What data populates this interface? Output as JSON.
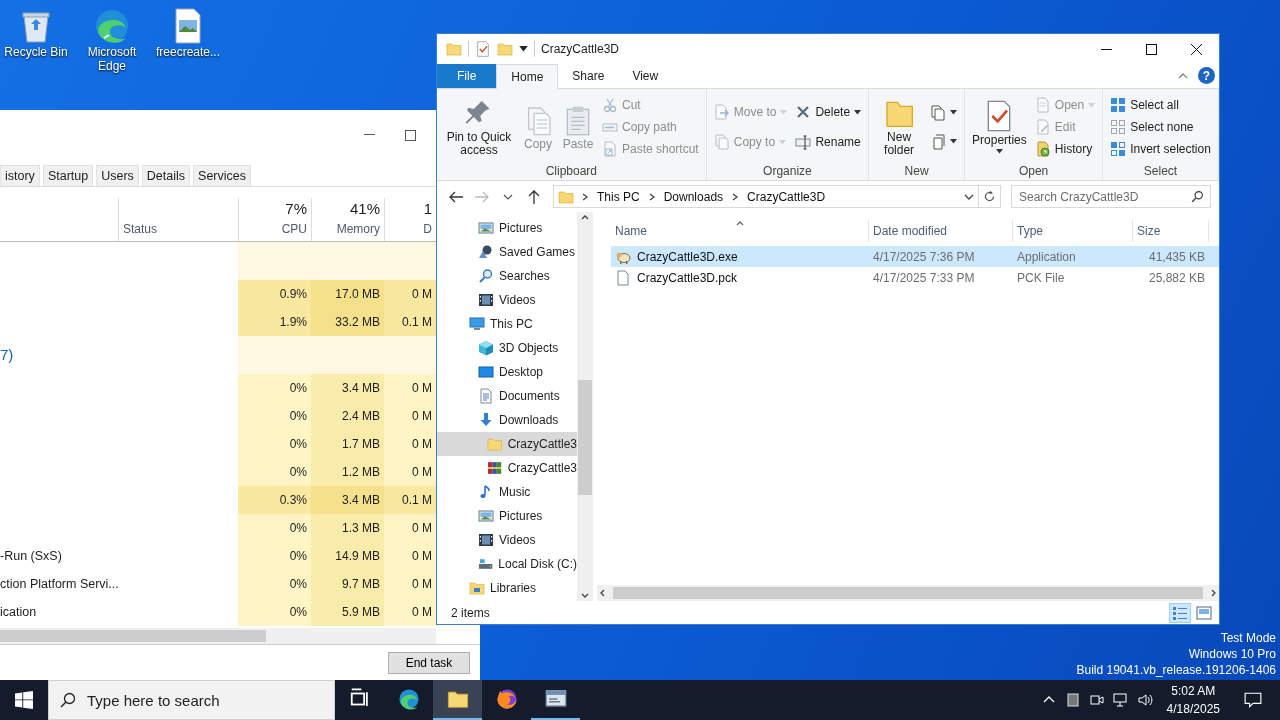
{
  "desktop_icons": [
    {
      "label": "Recycle Bin"
    },
    {
      "label": "Microsoft Edge"
    },
    {
      "label": "freecreate..."
    }
  ],
  "task_manager": {
    "tabs": [
      {
        "label": "istory",
        "selected": false
      },
      {
        "label": "Startup",
        "selected": false
      },
      {
        "label": "Users",
        "selected": false
      },
      {
        "label": "Details",
        "selected": false
      },
      {
        "label": "Services",
        "selected": false
      }
    ],
    "columns": [
      {
        "label": "Status"
      },
      {
        "total": "7%",
        "label": "CPU"
      },
      {
        "total": "41%",
        "label": "Memory"
      },
      {
        "total": "1",
        "label": "D"
      }
    ],
    "rows": [
      {
        "kind": "group"
      },
      {
        "kind": "process",
        "busy": true,
        "cpu": "0.9%",
        "memory": "17.0 MB",
        "disk": "0 M"
      },
      {
        "kind": "process",
        "busy": true,
        "cpu": "1.9%",
        "memory": "33.2 MB",
        "disk": "0.1 M"
      },
      {
        "kind": "group",
        "name": "7)"
      },
      {
        "kind": "process",
        "busy": false,
        "cpu": "0%",
        "memory": "3.4 MB",
        "disk": "0 M"
      },
      {
        "kind": "process",
        "busy": false,
        "cpu": "0%",
        "memory": "2.4 MB",
        "disk": "0 M"
      },
      {
        "kind": "process",
        "busy": false,
        "cpu": "0%",
        "memory": "1.7 MB",
        "disk": "0 M"
      },
      {
        "kind": "process",
        "busy": false,
        "cpu": "0%",
        "memory": "1.2 MB",
        "disk": "0 M"
      },
      {
        "kind": "process",
        "busy": true,
        "cpu": "0.3%",
        "memory": "3.4 MB",
        "disk": "0.1 M"
      },
      {
        "kind": "process",
        "busy": false,
        "cpu": "0%",
        "memory": "1.3 MB",
        "disk": "0 M"
      },
      {
        "kind": "process",
        "busy": false,
        "name": "-Run (SxS)",
        "cpu": "0%",
        "memory": "14.9 MB",
        "disk": "0 M"
      },
      {
        "kind": "process",
        "busy": false,
        "name": "ction Platform Servi...",
        "cpu": "0%",
        "memory": "9.7 MB",
        "disk": "0 M"
      },
      {
        "kind": "process",
        "busy": false,
        "name": "ication",
        "cpu": "0%",
        "memory": "5.9 MB",
        "disk": "0 M"
      }
    ],
    "end_task": "End task"
  },
  "explorer": {
    "title": "CrazyCattle3D",
    "tabs": [
      {
        "label": "File",
        "kind": "file",
        "selected": false
      },
      {
        "label": "Home",
        "kind": "tab",
        "selected": true
      },
      {
        "label": "Share",
        "kind": "tab",
        "selected": false
      },
      {
        "label": "View",
        "kind": "tab",
        "selected": false
      }
    ],
    "help": "?",
    "ribbon": [
      {
        "label": "Clipboard",
        "columns": [
          [
            {
              "label": "Pin to Quick access",
              "disabled": false
            }
          ],
          [
            {
              "label": "Copy",
              "disabled": true
            }
          ],
          [
            {
              "label": "Paste",
              "disabled": true
            }
          ],
          [
            {
              "label": "Cut",
              "disabled": true
            },
            {
              "label": "Copy path",
              "disabled": true
            },
            {
              "label": "Paste shortcut",
              "disabled": true
            }
          ]
        ]
      },
      {
        "label": "Organize",
        "columns": [
          [
            {
              "label": "Move to",
              "disabled": true,
              "dropdown": true
            },
            {
              "label": "Copy to",
              "disabled": true,
              "dropdown": true
            }
          ],
          [
            {
              "label": "Delete",
              "disabled": false,
              "dropdown": true
            },
            {
              "label": "Rename",
              "disabled": false
            }
          ]
        ]
      },
      {
        "label": "New",
        "columns": [
          [
            {
              "label": "New folder",
              "disabled": false
            }
          ],
          [
            {
              "disabled": false,
              "dropdown": true
            },
            {
              "disabled": false,
              "dropdown": true
            }
          ]
        ]
      },
      {
        "label": "Open",
        "columns": [
          [
            {
              "label": "Properties",
              "disabled": false,
              "dropdown": true
            }
          ],
          [
            {
              "label": "Open",
              "disabled": true,
              "dropdown": true
            },
            {
              "label": "Edit",
              "disabled": true
            },
            {
              "label": "History",
              "disabled": false
            }
          ]
        ]
      },
      {
        "label": "Select",
        "columns": [
          [
            {
              "label": "Select all",
              "disabled": false
            },
            {
              "label": "Select none",
              "disabled": false
            },
            {
              "label": "Invert selection",
              "disabled": false
            }
          ]
        ]
      }
    ],
    "breadcrumb": [
      "This PC",
      "Downloads",
      "CrazyCattle3D"
    ],
    "search": {
      "placeholder": "Search CrazyCattle3D"
    },
    "nav_pane": {
      "continued_items": [
        {
          "label": "Pictures",
          "selected": false
        },
        {
          "label": "Saved Games",
          "selected": false
        },
        {
          "label": "Searches",
          "selected": false
        },
        {
          "label": "Videos",
          "selected": false
        }
      ],
      "tree": [
        {
          "label": "This PC",
          "selected": false,
          "children": [
            {
              "label": "3D Objects",
              "selected": false
            },
            {
              "label": "Desktop",
              "selected": false
            },
            {
              "label": "Documents",
              "selected": false
            },
            {
              "label": "Downloads",
              "selected": false,
              "children": [
                {
                  "label": "CrazyCattle3",
                  "selected": true
                },
                {
                  "label": "CrazyCattle3",
                  "selected": false
                }
              ]
            },
            {
              "label": "Music",
              "selected": false
            },
            {
              "label": "Pictures",
              "selected": false
            },
            {
              "label": "Videos",
              "selected": false
            },
            {
              "label": "Local Disk (C:)",
              "selected": false
            }
          ]
        },
        {
          "label": "Libraries",
          "selected": false
        }
      ]
    },
    "files": {
      "columns": [
        "Name",
        "Date modified",
        "Type",
        "Size"
      ],
      "rows": [
        {
          "name": "CrazyCattle3D.exe",
          "date": "4/17/2025 7:36 PM",
          "type": "Application",
          "size": "41,435 KB",
          "selected": true
        },
        {
          "name": "CrazyCattle3D.pck",
          "date": "4/17/2025 7:33 PM",
          "type": "PCK File",
          "size": "25,882 KB",
          "selected": false
        }
      ]
    },
    "status": "2 items",
    "view_buttons": [
      {
        "selected": true
      },
      {
        "selected": false
      }
    ]
  },
  "os_info": [
    "Test Mode",
    "Windows 10 Pro",
    "Build 19041.vb_release.191206-1406"
  ],
  "taskbar": {
    "search_placeholder": "Type here to search",
    "apps": [
      {
        "running": false,
        "active": false
      },
      {
        "running": false,
        "active": false
      },
      {
        "running": true,
        "active": true
      },
      {
        "running": false,
        "active": false
      },
      {
        "running": true,
        "active": false
      }
    ],
    "time": "5:02 AM",
    "date": "4/18/2025"
  }
}
